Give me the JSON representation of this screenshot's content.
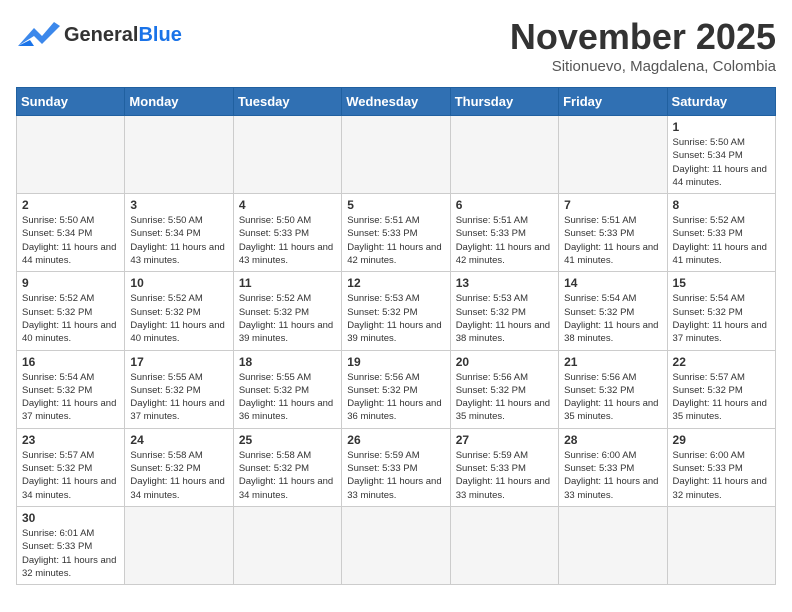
{
  "header": {
    "logo_general": "General",
    "logo_blue": "Blue",
    "month_title": "November 2025",
    "subtitle": "Sitionuevo, Magdalena, Colombia"
  },
  "weekdays": [
    "Sunday",
    "Monday",
    "Tuesday",
    "Wednesday",
    "Thursday",
    "Friday",
    "Saturday"
  ],
  "weeks": [
    [
      {
        "day": "",
        "info": ""
      },
      {
        "day": "",
        "info": ""
      },
      {
        "day": "",
        "info": ""
      },
      {
        "day": "",
        "info": ""
      },
      {
        "day": "",
        "info": ""
      },
      {
        "day": "",
        "info": ""
      },
      {
        "day": "1",
        "info": "Sunrise: 5:50 AM\nSunset: 5:34 PM\nDaylight: 11 hours and 44 minutes."
      }
    ],
    [
      {
        "day": "2",
        "info": "Sunrise: 5:50 AM\nSunset: 5:34 PM\nDaylight: 11 hours and 44 minutes."
      },
      {
        "day": "3",
        "info": "Sunrise: 5:50 AM\nSunset: 5:34 PM\nDaylight: 11 hours and 43 minutes."
      },
      {
        "day": "4",
        "info": "Sunrise: 5:50 AM\nSunset: 5:33 PM\nDaylight: 11 hours and 43 minutes."
      },
      {
        "day": "5",
        "info": "Sunrise: 5:51 AM\nSunset: 5:33 PM\nDaylight: 11 hours and 42 minutes."
      },
      {
        "day": "6",
        "info": "Sunrise: 5:51 AM\nSunset: 5:33 PM\nDaylight: 11 hours and 42 minutes."
      },
      {
        "day": "7",
        "info": "Sunrise: 5:51 AM\nSunset: 5:33 PM\nDaylight: 11 hours and 41 minutes."
      },
      {
        "day": "8",
        "info": "Sunrise: 5:52 AM\nSunset: 5:33 PM\nDaylight: 11 hours and 41 minutes."
      }
    ],
    [
      {
        "day": "9",
        "info": "Sunrise: 5:52 AM\nSunset: 5:32 PM\nDaylight: 11 hours and 40 minutes."
      },
      {
        "day": "10",
        "info": "Sunrise: 5:52 AM\nSunset: 5:32 PM\nDaylight: 11 hours and 40 minutes."
      },
      {
        "day": "11",
        "info": "Sunrise: 5:52 AM\nSunset: 5:32 PM\nDaylight: 11 hours and 39 minutes."
      },
      {
        "day": "12",
        "info": "Sunrise: 5:53 AM\nSunset: 5:32 PM\nDaylight: 11 hours and 39 minutes."
      },
      {
        "day": "13",
        "info": "Sunrise: 5:53 AM\nSunset: 5:32 PM\nDaylight: 11 hours and 38 minutes."
      },
      {
        "day": "14",
        "info": "Sunrise: 5:54 AM\nSunset: 5:32 PM\nDaylight: 11 hours and 38 minutes."
      },
      {
        "day": "15",
        "info": "Sunrise: 5:54 AM\nSunset: 5:32 PM\nDaylight: 11 hours and 37 minutes."
      }
    ],
    [
      {
        "day": "16",
        "info": "Sunrise: 5:54 AM\nSunset: 5:32 PM\nDaylight: 11 hours and 37 minutes."
      },
      {
        "day": "17",
        "info": "Sunrise: 5:55 AM\nSunset: 5:32 PM\nDaylight: 11 hours and 37 minutes."
      },
      {
        "day": "18",
        "info": "Sunrise: 5:55 AM\nSunset: 5:32 PM\nDaylight: 11 hours and 36 minutes."
      },
      {
        "day": "19",
        "info": "Sunrise: 5:56 AM\nSunset: 5:32 PM\nDaylight: 11 hours and 36 minutes."
      },
      {
        "day": "20",
        "info": "Sunrise: 5:56 AM\nSunset: 5:32 PM\nDaylight: 11 hours and 35 minutes."
      },
      {
        "day": "21",
        "info": "Sunrise: 5:56 AM\nSunset: 5:32 PM\nDaylight: 11 hours and 35 minutes."
      },
      {
        "day": "22",
        "info": "Sunrise: 5:57 AM\nSunset: 5:32 PM\nDaylight: 11 hours and 35 minutes."
      }
    ],
    [
      {
        "day": "23",
        "info": "Sunrise: 5:57 AM\nSunset: 5:32 PM\nDaylight: 11 hours and 34 minutes."
      },
      {
        "day": "24",
        "info": "Sunrise: 5:58 AM\nSunset: 5:32 PM\nDaylight: 11 hours and 34 minutes."
      },
      {
        "day": "25",
        "info": "Sunrise: 5:58 AM\nSunset: 5:32 PM\nDaylight: 11 hours and 34 minutes."
      },
      {
        "day": "26",
        "info": "Sunrise: 5:59 AM\nSunset: 5:33 PM\nDaylight: 11 hours and 33 minutes."
      },
      {
        "day": "27",
        "info": "Sunrise: 5:59 AM\nSunset: 5:33 PM\nDaylight: 11 hours and 33 minutes."
      },
      {
        "day": "28",
        "info": "Sunrise: 6:00 AM\nSunset: 5:33 PM\nDaylight: 11 hours and 33 minutes."
      },
      {
        "day": "29",
        "info": "Sunrise: 6:00 AM\nSunset: 5:33 PM\nDaylight: 11 hours and 32 minutes."
      }
    ],
    [
      {
        "day": "30",
        "info": "Sunrise: 6:01 AM\nSunset: 5:33 PM\nDaylight: 11 hours and 32 minutes."
      },
      {
        "day": "",
        "info": ""
      },
      {
        "day": "",
        "info": ""
      },
      {
        "day": "",
        "info": ""
      },
      {
        "day": "",
        "info": ""
      },
      {
        "day": "",
        "info": ""
      },
      {
        "day": "",
        "info": ""
      }
    ]
  ]
}
